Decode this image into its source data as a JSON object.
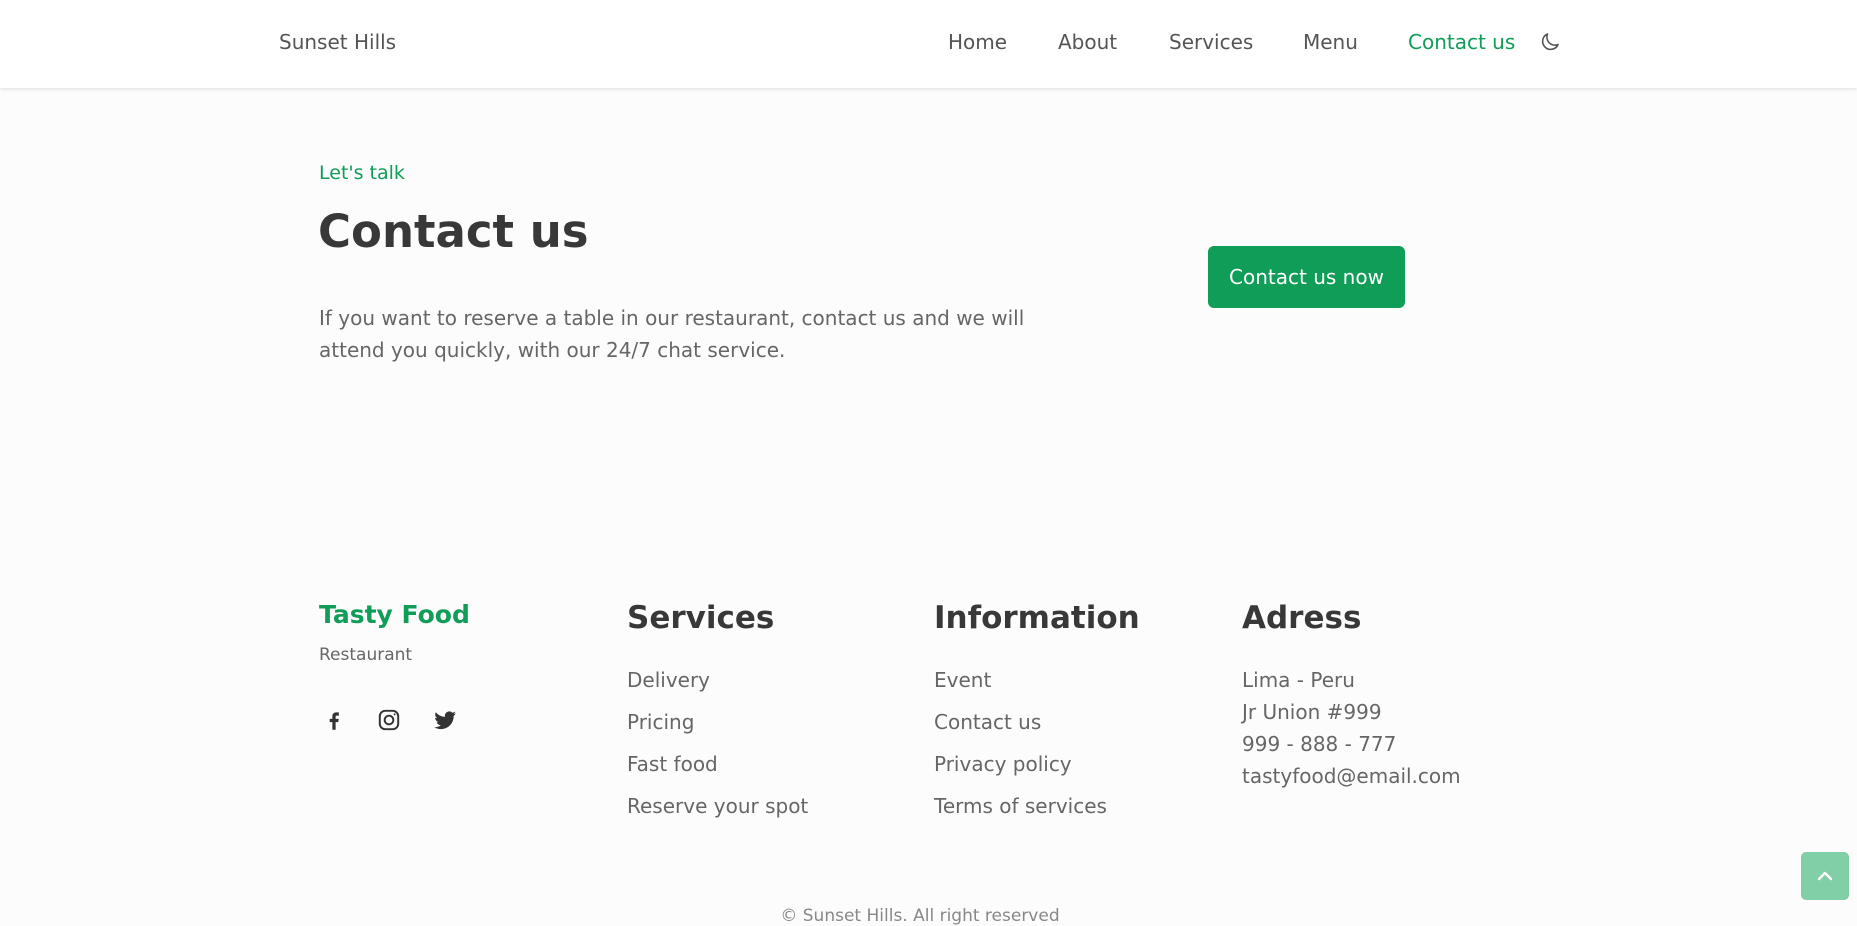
{
  "header": {
    "logo": "Sunset Hills",
    "nav": [
      {
        "label": "Home"
      },
      {
        "label": "About"
      },
      {
        "label": "Services"
      },
      {
        "label": "Menu"
      },
      {
        "label": "Contact us",
        "active": true
      }
    ],
    "theme_icon": "moon-icon"
  },
  "contact": {
    "subtitle": "Let's talk",
    "title": "Contact us",
    "description": "If you want to reserve a table in our restaurant, contact us and we will attend you quickly, with our 24/7 chat service.",
    "button_label": "Contact us now"
  },
  "footer": {
    "brand": "Tasty Food",
    "brand_sub": "Restaurant",
    "social_icons": [
      "facebook-icon",
      "instagram-icon",
      "twitter-icon"
    ],
    "services": {
      "title": "Services",
      "links": [
        "Delivery",
        "Pricing",
        "Fast food",
        "Reserve your spot"
      ]
    },
    "information": {
      "title": "Information",
      "links": [
        "Event",
        "Contact us",
        "Privacy policy",
        "Terms of services"
      ]
    },
    "address": {
      "title": "Adress",
      "lines": [
        "Lima - Peru",
        "Jr Union #999",
        "999 - 888 - 777",
        "tastyfood@email.com"
      ]
    },
    "copyright": "© Sunset Hills. All right reserved"
  },
  "colors": {
    "accent": "#0f9d58",
    "heading": "#383838",
    "text": "#666666",
    "scroll_button": "#80cfa6"
  }
}
